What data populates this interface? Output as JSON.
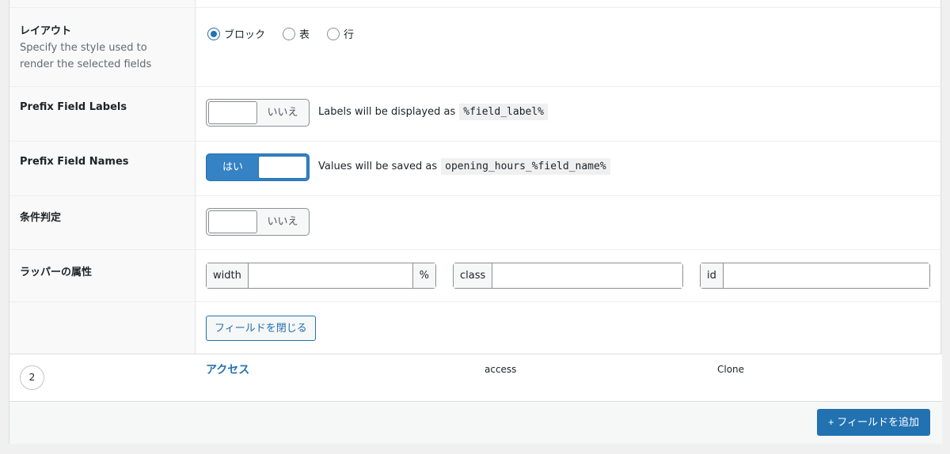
{
  "layout_row": {
    "label": "レイアウト",
    "description": "Specify the style used to render the selected fields",
    "options": [
      {
        "label": "ブロック",
        "checked": true
      },
      {
        "label": "表",
        "checked": false
      },
      {
        "label": "行",
        "checked": false
      }
    ]
  },
  "prefix_labels_row": {
    "label": "Prefix Field Labels",
    "toggle_text": "いいえ",
    "hint_text": "Labels will be displayed as",
    "hint_code": "%field_label%"
  },
  "prefix_names_row": {
    "label": "Prefix Field Names",
    "toggle_text": "はい",
    "hint_text": "Values will be saved as",
    "hint_code": "opening_hours_%field_name%"
  },
  "conditional_row": {
    "label": "条件判定",
    "toggle_text": "いいえ"
  },
  "wrapper_row": {
    "label": "ラッパーの属性",
    "width_prefix": "width",
    "width_suffix": "%",
    "width_value": "",
    "class_prefix": "class",
    "class_value": "",
    "id_prefix": "id",
    "id_value": ""
  },
  "close_field_button": "フィールドを閉じる",
  "field_row": {
    "order": "2",
    "label": "アクセス",
    "name": "access",
    "type": "Clone"
  },
  "add_field_button": "+ フィールドを追加",
  "colors": {
    "accent": "#2271b1",
    "toggle_on": "#3582c4",
    "label_column_bg": "#f9f9f9"
  }
}
